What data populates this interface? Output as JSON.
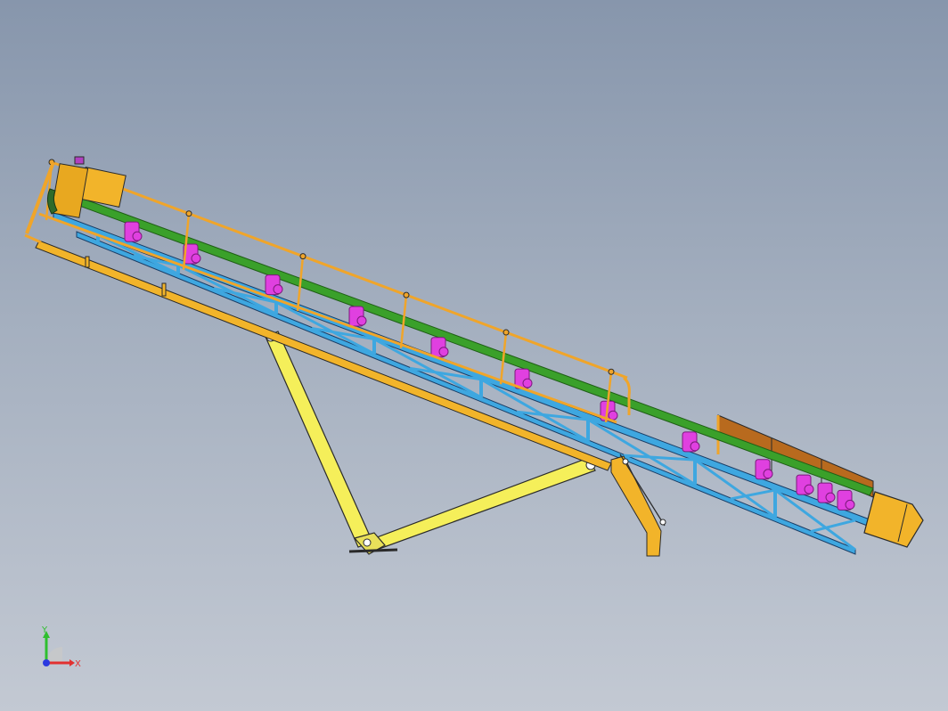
{
  "view": {
    "background_top": "#8796ac",
    "background_bottom": "#c3c9d3"
  },
  "colors": {
    "frame_blue": "#3ea7e0",
    "guardrail_orange": "#f0a52a",
    "belt_green": "#3aa02a",
    "idler_magenta": "#e040e0",
    "leg_yellow": "#f5ef5a",
    "hopper_brown": "#b86a1e",
    "housing_orange": "#f2b42a",
    "outline": "#2a2a2a"
  },
  "triad": {
    "x_label": "X",
    "y_label": "Y",
    "x_color": "#e23030",
    "y_color": "#2fbf2f",
    "z_color": "#2a3ae0"
  }
}
